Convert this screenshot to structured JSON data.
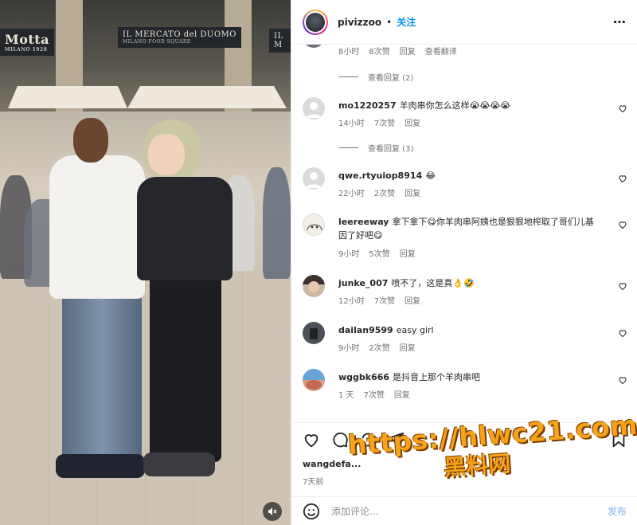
{
  "header": {
    "username": "pivizzoo",
    "dot": "•",
    "follow_label": "关注"
  },
  "media": {
    "signs": [
      "Motta",
      "IL MERCATO del DUOMO",
      "MILANO FOOD SQUARE",
      "IL M"
    ],
    "sign_small": "MILANO 1928"
  },
  "top_comment_meta": {
    "time": "8小时",
    "likes": "8次赞",
    "reply": "回复",
    "translate": "查看翻译"
  },
  "comments": [
    {
      "username": "mo1220257",
      "text": "羊肉串你怎么这样😭😭😭😭",
      "time": "14小时",
      "likes": "7次赞",
      "reply": "回复",
      "replies": "查看回复 (3)",
      "avatar_color": "#dbdbdb"
    },
    {
      "username": "qwe.rtyuiop8914",
      "text": "😂",
      "time": "22小时",
      "likes": "2次赞",
      "reply": "回复",
      "replies": "",
      "avatar_color": "#dbdbdb"
    },
    {
      "username": "leereeway",
      "text": "拿下拿下😋你羊肉串阿姨也是狠狠地榨取了哥们儿基因了好吧😋",
      "time": "9小时",
      "likes": "5次赞",
      "reply": "回复",
      "replies": "",
      "avatar_color": "#f3efe6"
    },
    {
      "username": "junke_007",
      "text": "喷不了，这是真👌🤣",
      "time": "12小时",
      "likes": "7次赞",
      "reply": "回复",
      "replies": "",
      "avatar_color": "#c9b8a4"
    },
    {
      "username": "dailan9599",
      "text": "easy girl",
      "time": "9小时",
      "likes": "2次赞",
      "reply": "回复",
      "replies": "",
      "avatar_color": "#4c5057"
    },
    {
      "username": "wggbk666",
      "text": "是抖音上那个羊肉串吧",
      "time": "1 天",
      "likes": "7次赞",
      "reply": "回复",
      "replies": "",
      "avatar_color": "#d8a08a"
    }
  ],
  "first_replies": "查看回复 (2)",
  "likes_line": "wangdefa...",
  "post_time": "7天前",
  "add_comment": {
    "placeholder": "添加评论...",
    "post_label": "发布"
  },
  "watermark": {
    "line1": "https://hlwc21.com",
    "line2": "黑料网"
  },
  "colors": {
    "accent": "#0095f6",
    "muted": "#737373",
    "watermark": "#f6a21b"
  }
}
